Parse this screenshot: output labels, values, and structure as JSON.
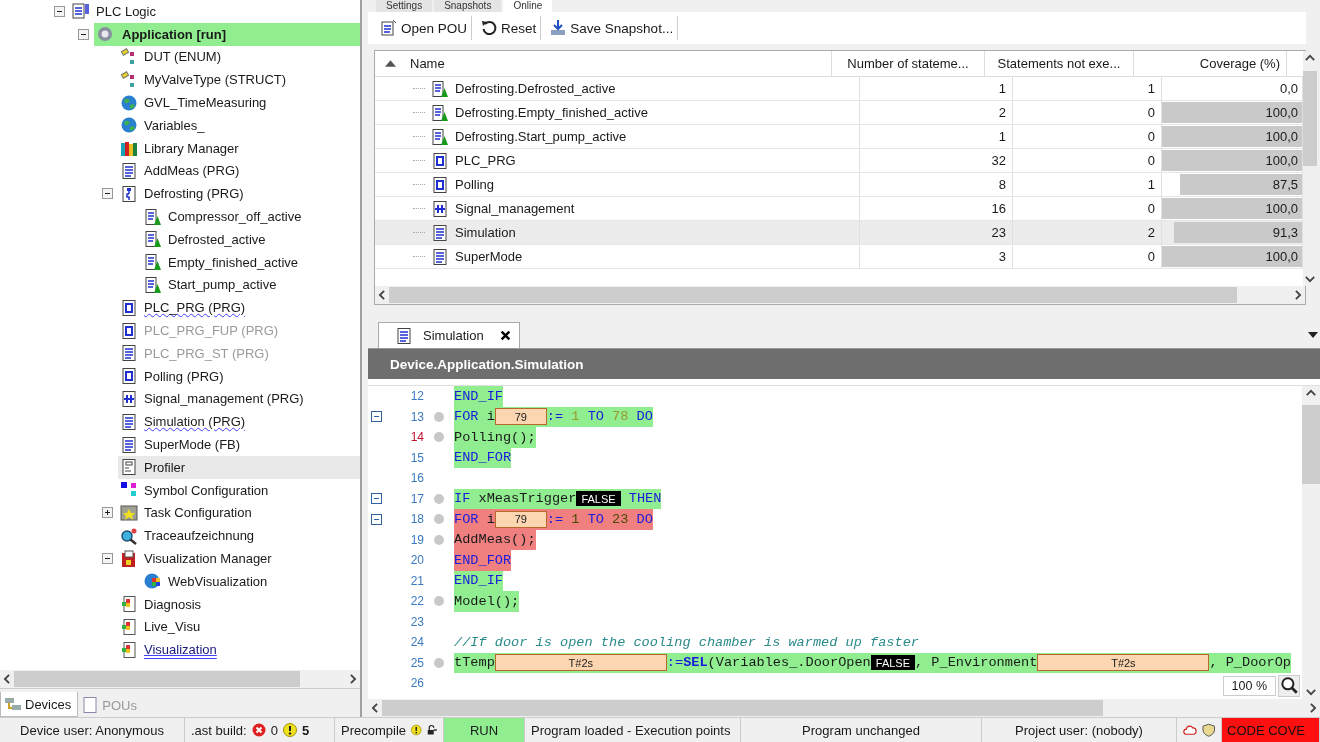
{
  "project_tree": [
    {
      "label": "PLC Logic",
      "kind": "plc",
      "selected": false,
      "disabled": false,
      "running": false,
      "expanded": true,
      "children": [
        {
          "label": "Application [run]",
          "kind": "gear",
          "selected": false,
          "disabled": false,
          "running": true,
          "expanded": true,
          "children": [
            {
              "label": "DUT (ENUM)",
              "kind": "dut",
              "selected": false,
              "disabled": false,
              "running": false
            },
            {
              "label": "MyValveType (STRUCT)",
              "kind": "dut",
              "selected": false,
              "disabled": false,
              "running": false
            },
            {
              "label": "GVL_TimeMeasuring",
              "kind": "gvl",
              "selected": false,
              "disabled": false,
              "running": false
            },
            {
              "label": "Variables_",
              "kind": "gvl",
              "selected": false,
              "disabled": false,
              "running": false
            },
            {
              "label": "Library Manager",
              "kind": "library",
              "selected": false,
              "disabled": false,
              "running": false
            },
            {
              "label": "AddMeas (PRG)",
              "kind": "pou",
              "selected": false,
              "disabled": false,
              "running": false
            },
            {
              "label": "Defrosting (PRG)",
              "kind": "sfc",
              "selected": false,
              "disabled": false,
              "running": false,
              "expanded": true,
              "children": [
                {
                  "label": "Compressor_off_active",
                  "kind": "action",
                  "selected": false,
                  "disabled": false,
                  "running": false
                },
                {
                  "label": "Defrosted_active",
                  "kind": "action",
                  "selected": false,
                  "disabled": false,
                  "running": false
                },
                {
                  "label": "Empty_finished_active",
                  "kind": "action",
                  "selected": false,
                  "disabled": false,
                  "running": false
                },
                {
                  "label": "Start_pump_active",
                  "kind": "action",
                  "selected": false,
                  "disabled": false,
                  "running": false
                }
              ]
            },
            {
              "label": "PLC_PRG (PRG)",
              "kind": "prg",
              "selected": false,
              "disabled": false,
              "running": false,
              "flagged": true
            },
            {
              "label": "PLC_PRG_FUP (PRG)",
              "kind": "fbd",
              "selected": false,
              "disabled": true,
              "running": false
            },
            {
              "label": "PLC_PRG_ST (PRG)",
              "kind": "pou",
              "selected": false,
              "disabled": true,
              "running": false
            },
            {
              "label": "Polling (PRG)",
              "kind": "prg",
              "selected": false,
              "disabled": false,
              "running": false
            },
            {
              "label": "Signal_management (PRG)",
              "kind": "signal",
              "selected": false,
              "disabled": false,
              "running": false
            },
            {
              "label": "Simulation (PRG)",
              "kind": "pou",
              "selected": false,
              "disabled": false,
              "running": false,
              "flagged": true
            },
            {
              "label": "SuperMode (FB)",
              "kind": "pou",
              "selected": false,
              "disabled": false,
              "running": false
            },
            {
              "label": "Profiler",
              "kind": "profiler",
              "selected": true,
              "disabled": false,
              "running": false
            },
            {
              "label": "Symbol Configuration",
              "kind": "symbol",
              "selected": false,
              "disabled": false,
              "running": false
            },
            {
              "label": "Task Configuration",
              "kind": "task",
              "selected": false,
              "disabled": false,
              "running": false,
              "expanded": false
            },
            {
              "label": "Traceaufzeichnung",
              "kind": "trace",
              "selected": false,
              "disabled": false,
              "running": false
            },
            {
              "label": "Visualization Manager",
              "kind": "visumgr",
              "selected": false,
              "disabled": false,
              "running": false,
              "expanded": true,
              "children": [
                {
                  "label": "WebVisualization",
                  "kind": "webvisu",
                  "selected": false,
                  "disabled": false,
                  "running": false
                }
              ]
            },
            {
              "label": "Diagnosis",
              "kind": "visu",
              "selected": false,
              "disabled": false,
              "running": false
            },
            {
              "label": "Live_Visu",
              "kind": "visu",
              "selected": false,
              "disabled": false,
              "running": false
            },
            {
              "label": "Visualization",
              "kind": "visu",
              "selected": false,
              "disabled": false,
              "running": false,
              "linked": true
            }
          ]
        }
      ]
    }
  ],
  "left_tabs": [
    {
      "label": "Devices",
      "kind": "devices",
      "selected": true
    },
    {
      "label": "POUs",
      "kind": "pous",
      "selected": false
    }
  ],
  "profiler_tabs": [
    {
      "label": "Settings",
      "selected": false
    },
    {
      "label": "Snapshots",
      "selected": false
    },
    {
      "label": "Online",
      "selected": true
    }
  ],
  "toolbar": [
    {
      "label": "Open POU",
      "kind": "open"
    },
    {
      "label": "Reset",
      "kind": "reset"
    },
    {
      "label": "Save Snapshot...",
      "kind": "save"
    }
  ],
  "coverage_table": {
    "columns": [
      {
        "label": "Name",
        "sorted": true
      },
      {
        "label": "Number of stateme...",
        "sorted": false
      },
      {
        "label": "Statements not exe...",
        "sorted": false
      },
      {
        "label": "Coverage (%)",
        "sorted": false
      }
    ],
    "rows": [
      {
        "kind": "action",
        "name": "Defrosting.Defrosted_active",
        "statements": "1",
        "not_executed": "1",
        "coverage": "0,0",
        "level": 0,
        "selected": false
      },
      {
        "kind": "action",
        "name": "Defrosting.Empty_finished_active",
        "statements": "2",
        "not_executed": "0",
        "coverage": "100,0",
        "level": 1,
        "selected": false
      },
      {
        "kind": "action",
        "name": "Defrosting.Start_pump_active",
        "statements": "1",
        "not_executed": "0",
        "coverage": "100,0",
        "level": 1,
        "selected": false
      },
      {
        "kind": "prg",
        "name": "PLC_PRG",
        "statements": "32",
        "not_executed": "0",
        "coverage": "100,0",
        "level": 1,
        "selected": false
      },
      {
        "kind": "prg",
        "name": "Polling",
        "statements": "8",
        "not_executed": "1",
        "coverage": "87,5",
        "level": 0.875,
        "selected": false
      },
      {
        "kind": "signal",
        "name": "Signal_management",
        "statements": "16",
        "not_executed": "0",
        "coverage": "100,0",
        "level": 1,
        "selected": false
      },
      {
        "kind": "pou",
        "name": "Simulation",
        "statements": "23",
        "not_executed": "2",
        "coverage": "91,3",
        "level": 0.913,
        "selected": true
      },
      {
        "kind": "pou",
        "name": "SuperMode",
        "statements": "3",
        "not_executed": "0",
        "coverage": "100,0",
        "level": 1,
        "selected": false
      }
    ]
  },
  "editor": {
    "tab": "Simulation",
    "path": "Device.Application.Simulation",
    "zoom": "100 %",
    "lines": [
      {
        "number": "12",
        "fold": false,
        "point": false,
        "current": false,
        "executed": true,
        "tokens": [
          {
            "kind": "kw",
            "text": "END_IF"
          }
        ]
      },
      {
        "number": "13",
        "fold": true,
        "point": true,
        "current": false,
        "executed": true,
        "tokens": [
          {
            "kind": "kw",
            "text": "FOR "
          },
          {
            "kind": "id",
            "text": "i"
          },
          {
            "kind": "int_value",
            "text": "79"
          },
          {
            "kind": "op",
            "text": ":= "
          },
          {
            "kind": "num",
            "text": "1"
          },
          {
            "kind": "kw",
            "text": " TO "
          },
          {
            "kind": "num",
            "text": "78"
          },
          {
            "kind": "kw",
            "text": " DO"
          }
        ]
      },
      {
        "number": "14",
        "fold": false,
        "point": true,
        "current": true,
        "executed": true,
        "tokens": [
          {
            "kind": "id",
            "text": "    Polling();"
          }
        ]
      },
      {
        "number": "15",
        "fold": false,
        "point": false,
        "current": false,
        "executed": true,
        "tokens": [
          {
            "kind": "kw",
            "text": "END_FOR"
          }
        ]
      },
      {
        "number": "16",
        "fold": false,
        "point": false,
        "current": false
      },
      {
        "number": "17",
        "fold": true,
        "point": true,
        "current": false,
        "executed": true,
        "tokens": [
          {
            "kind": "kw",
            "text": "IF "
          },
          {
            "kind": "id",
            "text": "xMeasTrigger"
          },
          {
            "kind": "flag",
            "text": "FALSE"
          },
          {
            "kind": "kw",
            "text": " THEN"
          }
        ]
      },
      {
        "number": "18",
        "fold": true,
        "point": true,
        "current": false,
        "executed": false,
        "tokens": [
          {
            "kind": "kw",
            "text": "    FOR "
          },
          {
            "kind": "id",
            "text": "i"
          },
          {
            "kind": "int_value",
            "text": "79"
          },
          {
            "kind": "op",
            "text": ":= "
          },
          {
            "kind": "num",
            "text": "1"
          },
          {
            "kind": "kw",
            "text": " TO "
          },
          {
            "kind": "num",
            "text": "23"
          },
          {
            "kind": "kw",
            "text": " DO"
          }
        ]
      },
      {
        "number": "19",
        "fold": false,
        "point": true,
        "current": false,
        "executed": false,
        "tokens": [
          {
            "kind": "id",
            "text": "        AddMeas();"
          }
        ]
      },
      {
        "number": "20",
        "fold": false,
        "point": false,
        "current": false,
        "executed": false,
        "tokens": [
          {
            "kind": "kw",
            "text": "    END_FOR"
          }
        ]
      },
      {
        "number": "21",
        "fold": false,
        "point": false,
        "current": false,
        "executed": true,
        "tokens": [
          {
            "kind": "kw",
            "text": "END_IF"
          }
        ]
      },
      {
        "number": "22",
        "fold": false,
        "point": true,
        "current": false,
        "executed": true,
        "tokens": [
          {
            "kind": "id",
            "text": "Model();"
          }
        ]
      },
      {
        "number": "23",
        "fold": false,
        "point": false,
        "current": false
      },
      {
        "number": "24",
        "fold": false,
        "point": false,
        "current": false,
        "tokens": [
          {
            "kind": "cmt",
            "text": "//If door is open the cooling chamber is warmed up faster"
          }
        ]
      },
      {
        "number": "25",
        "fold": false,
        "point": true,
        "current": false,
        "executed": true,
        "tokens": [
          {
            "kind": "id",
            "text": "tTemp"
          },
          {
            "kind": "time_value",
            "text": "T#2s"
          },
          {
            "kind": "op",
            "text": ":="
          },
          {
            "kind": "fn",
            "text": "SEL"
          },
          {
            "kind": "id",
            "text": "(Variables_.DoorOpen"
          },
          {
            "kind": "flag",
            "text": "FALSE"
          },
          {
            "kind": "id",
            "text": ", P_Environment"
          },
          {
            "kind": "time_value",
            "text": "T#2s"
          },
          {
            "kind": "id",
            "text": ", P_DoorOp"
          }
        ]
      },
      {
        "number": "26",
        "fold": false,
        "point": false,
        "current": false
      }
    ]
  },
  "status_bar": {
    "device_user": "Device user: Anonymous",
    "build_label": ".ast build:",
    "errors": "0",
    "warnings": "5",
    "precompile": "Precompile",
    "run_state": "RUN",
    "message": "Program loaded - Execution points",
    "program_state": "Program unchanged",
    "project_user": "Project user: (nobody)",
    "mode": "CODE COVE"
  }
}
